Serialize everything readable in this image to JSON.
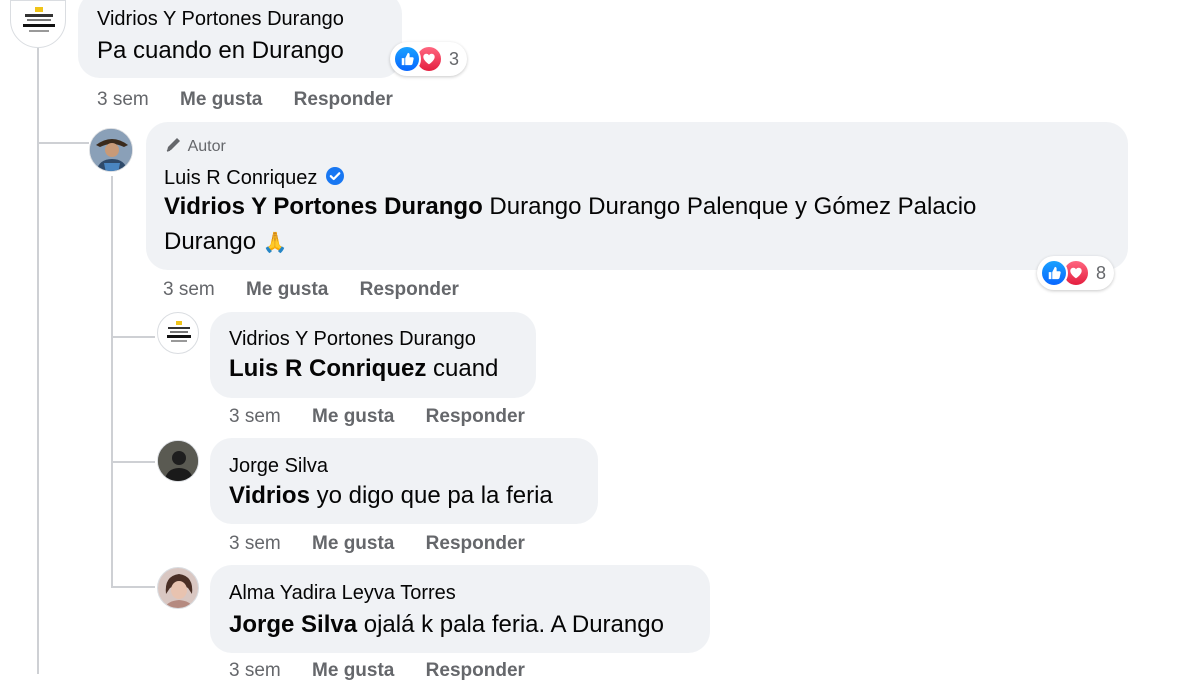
{
  "comments": [
    {
      "author": "Vidrios Y Portones Durango",
      "text": "Pa cuando en Durango",
      "time": "3 sem",
      "like_label": "Me gusta",
      "reply_label": "Responder",
      "reaction_count": "3"
    },
    {
      "author_tag": "Autor",
      "author": "Luis R Conriquez",
      "mention": "Vidrios Y Portones Durango",
      "text_line1": "Durango Durango Palenque y Gómez Palacio",
      "text_line2": "Durango",
      "emoji": "🙏",
      "time": "3 sem",
      "like_label": "Me gusta",
      "reply_label": "Responder",
      "reaction_count": "8"
    },
    {
      "author": "Vidrios Y Portones Durango",
      "mention": "Luis R Conriquez",
      "text": "cuand",
      "time": "3 sem",
      "like_label": "Me gusta",
      "reply_label": "Responder"
    },
    {
      "author": "Jorge Silva",
      "mention": "Vidrios",
      "text": "yo digo que pa la feria",
      "time": "3 sem",
      "like_label": "Me gusta",
      "reply_label": "Responder"
    },
    {
      "author": "Alma Yadira Leyva Torres",
      "mention": "Jorge Silva",
      "text": "ojalá k pala feria. A Durango",
      "time": "3 sem",
      "like_label": "Me gusta",
      "reply_label": "Responder"
    }
  ],
  "colors": {
    "bubble": "#f0f2f5",
    "meta_text": "#65676b",
    "like_blue": "#0866ff",
    "love_red": "#e41e3f",
    "verified_blue": "#1877f2",
    "thread_line": "#ced0d4"
  },
  "icons": {
    "verified": "verified-badge-icon",
    "author_tag": "pencil-icon",
    "like": "like-reaction-icon",
    "love": "love-reaction-icon"
  }
}
